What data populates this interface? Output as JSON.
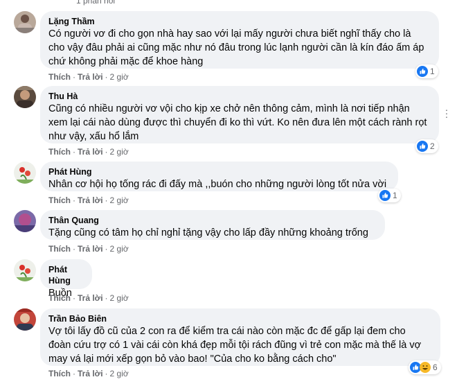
{
  "top_partial": "1 phản hồi",
  "actions": {
    "like": "Thích",
    "reply": "Trả lời",
    "separator": "·"
  },
  "comments": [
    {
      "author": "Lặng Thầm",
      "text": "Có người vơ đi cho gọn nhà hay sao với lại mấy người chưa biết nghĩ thấy cho là\ncho vậy đâu phải ai cũng mặc như nó đâu trong lúc lạnh người cần là kín đáo ấm áp\nchứ không phải mặc để khoe hàng",
      "time": "2 giờ",
      "reactions": [
        "like"
      ],
      "reaction_count": "1"
    },
    {
      "author": "Thu Hà",
      "text": "Cũng có nhiều người vơ vội cho kịp xe chở nên thông cảm, mình là nơi tiếp nhận\nxem lại cái nào dùng được thì chuyển đi ko thì vứt. Ko nên đưa lên một cách rành rọt\nnhư vậy, xấu hổ lắm",
      "time": "2 giờ",
      "reactions": [
        "like"
      ],
      "reaction_count": "2"
    },
    {
      "author": "Phát Hùng",
      "text": "Nhân cơ hội họ tống rác đi đấy mà ,,buón cho những người lòng tốt nửa vời",
      "time": "2 giờ",
      "reactions": [
        "like"
      ],
      "reaction_count": "1"
    },
    {
      "author": "Thân Quang",
      "text": "Tặng cũng có tâm họ chỉ nghỉ tặng vậy cho lấp đầy những khoảng trống",
      "time": "2 giờ",
      "reactions": [],
      "reaction_count": ""
    },
    {
      "author": "Phát Hùng",
      "text": "Buồn",
      "time": "2 giờ",
      "reactions": [],
      "reaction_count": ""
    },
    {
      "author": "Trần Bảo Biên",
      "text": "Vợ tôi lấy đồ cũ của 2 con ra để kiểm tra cái nào còn mặc đc để gấp lại đem cho\nđoàn cứu trợ có 1 vài cái còn khá đẹp mỗi tội rách đũng vì trẻ con mặc mà thế là vợ\nmay vá lại mới xếp gọn bỏ vào bao! \"Của cho ko bằng cách cho\"",
      "time": "2 giờ",
      "reactions": [
        "like",
        "haha"
      ],
      "reaction_count": "6"
    }
  ],
  "colors": {
    "bubble": "#f0f2f5",
    "like": "#1877f2",
    "haha": "#f7b928",
    "meta": "#65676b"
  }
}
